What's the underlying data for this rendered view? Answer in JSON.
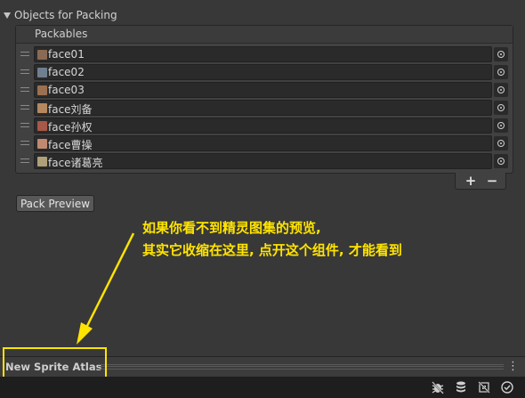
{
  "foldout": {
    "label": "Objects for Packing"
  },
  "list": {
    "header": "Packables",
    "items": [
      {
        "name": "face01",
        "thumb_color": "#8a6a55"
      },
      {
        "name": "face02",
        "thumb_color": "#6f7f8f"
      },
      {
        "name": "face03",
        "thumb_color": "#9a7050"
      },
      {
        "name": "face刘备",
        "thumb_color": "#b58860"
      },
      {
        "name": "face孙权",
        "thumb_color": "#a85848"
      },
      {
        "name": "face曹操",
        "thumb_color": "#c08a70"
      },
      {
        "name": "face诸葛亮",
        "thumb_color": "#b0a078"
      }
    ],
    "add_label": "+",
    "remove_label": "−"
  },
  "pack_preview_label": "Pack Preview",
  "annotation": {
    "line1": "如果你看不到精灵图集的预览,",
    "line2": "其实它收缩在这里, 点开这个组件, 才能看到",
    "color": "#ffe400"
  },
  "preview_bar": {
    "title": "New Sprite Atlas",
    "menu_label": "⋮"
  },
  "status_icons": [
    "debug-icon",
    "layers-icon",
    "no-debug-icon",
    "check-circle-icon"
  ]
}
